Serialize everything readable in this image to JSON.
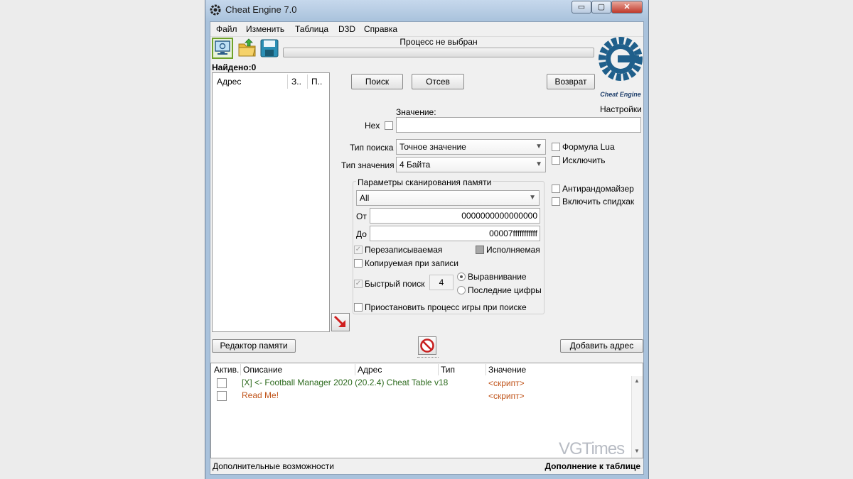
{
  "window": {
    "title": "Cheat Engine 7.0",
    "minimize_glyph": "▭",
    "maximize_glyph": "▢",
    "close_glyph": "✕"
  },
  "menu": [
    "Файл",
    "Изменить",
    "Таблица",
    "D3D",
    "Справка"
  ],
  "toolbar": {
    "process_label": "Процесс не выбран",
    "icons": [
      "computer-select-process-icon",
      "open-folder-icon",
      "save-disk-icon"
    ]
  },
  "scan": {
    "found_label": "Найдено:0",
    "results_columns": [
      "Адрес",
      "З..",
      "П.."
    ],
    "first_scan": "Поиск",
    "next_scan": "Отсев",
    "undo_scan": "Возврат",
    "settings": "Настройки",
    "value_label": "Значение:",
    "hex_label": "Hex",
    "scan_type_label": "Тип поиска",
    "scan_type_value": "Точное значение",
    "value_type_label": "Тип значения",
    "value_type_value": "4 Байта",
    "lua_formula": "Формула Lua",
    "exclude": "Исключить",
    "anti_randomizer": "Антирандомайзер",
    "speedhack": "Включить спидхак",
    "logo_text": "Cheat Engine"
  },
  "memory": {
    "group_title": "Параметры сканирования памяти",
    "region_value": "All",
    "from_label": "От",
    "from_value": "0000000000000000",
    "to_label": "До",
    "to_value": "00007fffffffffff",
    "writable": "Перезаписываемая",
    "executable": "Исполняемая",
    "copy_on_write": "Копируемая при записи",
    "fast_scan": "Быстрый поиск",
    "fast_scan_value": "4",
    "alignment": "Выравнивание",
    "last_digits": "Последние цифры",
    "pause_game": "Приостановить процесс игры при поиске"
  },
  "actions": {
    "memory_view": "Редактор памяти",
    "add_address": "Добавить адрес"
  },
  "table": {
    "columns": [
      "Актив.",
      "Описание",
      "Адрес",
      "Тип",
      "Значение"
    ],
    "rows": [
      {
        "description": "[X] <- Football Manager 2020 (20.2.4) Cheat Table v18",
        "value": "<скрипт>",
        "color": "#2e6b1f"
      },
      {
        "description": "Read Me!",
        "value": "<скрипт>",
        "color": "#c0541a"
      }
    ]
  },
  "status": {
    "left": "Дополнительные возможности",
    "right": "Дополнение к таблице"
  },
  "watermark": "VGTimes",
  "colors": {
    "script_value": "#c0541a",
    "accent_green": "#6fa22a",
    "logo_blue": "#1f5f8b"
  }
}
